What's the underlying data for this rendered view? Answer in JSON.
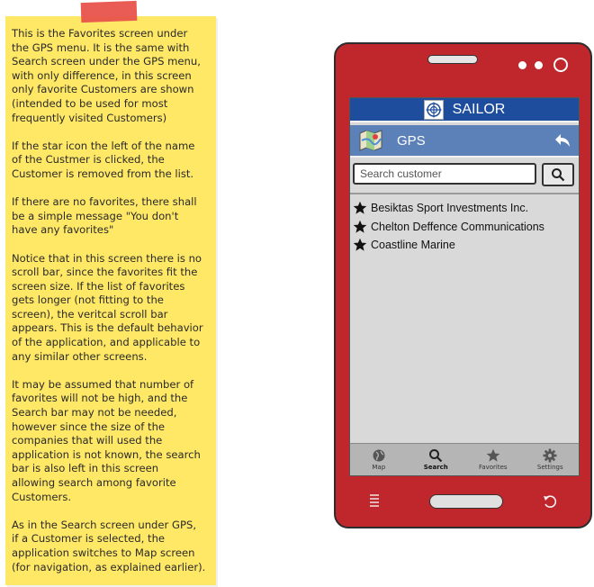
{
  "note": {
    "paragraphs": [
      "This is the Favorites screen under\nthe GPS menu. It is the same with\nSearch screen under the GPS menu,\nwith only difference, in this screen\nonly favorite Customers are shown\n(intended to be used for most\nfrequently visited Customers)",
      "If the star icon the left of the name\nof the Custmer is clicked, the\nCustomer is removed from the list.",
      "If there are no favorites, there shall\nbe a simple message \"You don't\nhave any favorites\"",
      "Notice that in this screen there is no\nscroll bar, since the favorites fit the\nscreen size. If the list of favorites\ngets longer (not fitting to the\nscreen), the veritcal scroll bar\nappears. This is the default behavior\nof the application, and applicable to\nany similar other screens.",
      "It may be assumed that number of\nfavorites will not be high, and the\nSearch bar may not be needed,\nhowever since the size of the\ncompanies that will used the\napplication is not known, the search\nbar is also left in this screen\nallowing search among favorite\nCustomers.",
      "As in the Search screen under GPS,\nif a Customer is selected, the\napplication switches to Map screen\n(for navigation, as explained earlier)."
    ]
  },
  "app": {
    "title": "SAILOR",
    "section": "GPS",
    "search": {
      "placeholder": "Search customer",
      "value": ""
    },
    "favorites": [
      "Besiktas Sport Investments Inc.",
      "Chelton Deffence Communications",
      "Coastline Marine"
    ],
    "tabs": [
      "Map",
      "Search",
      "Favorites",
      "Settings"
    ],
    "active_tab": "Search"
  },
  "colors": {
    "note_bg": "#ffe866",
    "tape": "#e8534c",
    "phone_body": "#c0272d",
    "title_bar": "#1f4d9e",
    "gps_bar": "#5b81b8"
  }
}
